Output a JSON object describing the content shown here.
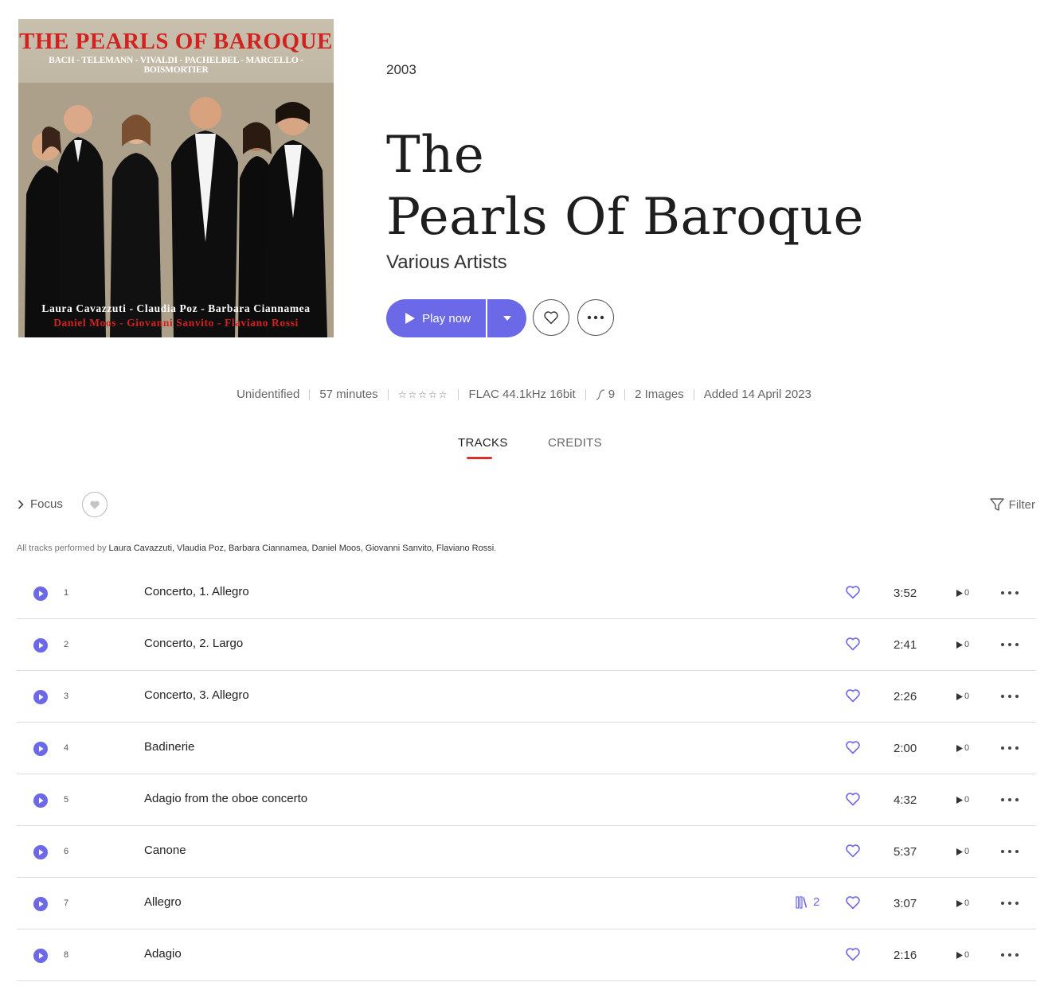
{
  "cover": {
    "title": "THE PEARLS OF BAROQUE",
    "composers": "BACH - TELEMANN - VIVALDI - PACHELBEL - MARCELLO - BOISMORTIER",
    "names_line1": "Laura Cavazzuti - Claudia Poz - Barbara Ciannamea",
    "names_line2": "Daniel Moos - Giovanni Sanvito - Flaviano Rossi"
  },
  "album": {
    "year": "2003",
    "title_line1": "The",
    "title_line2": "Pearls Of Baroque",
    "artist": "Various Artists"
  },
  "actions": {
    "play_label": "Play now"
  },
  "meta": {
    "identification": "Unidentified",
    "duration": "57 minutes",
    "rating_stars": "☆☆☆☆☆",
    "format": "FLAC 44.1kHz 16bit",
    "count": "9",
    "images": "2 Images",
    "added": "Added 14 April 2023"
  },
  "tabs": {
    "tracks": "TRACKS",
    "credits": "CREDITS"
  },
  "toolbar": {
    "focus": "Focus",
    "filter": "Filter"
  },
  "performed": {
    "prefix": "All tracks performed by",
    "names": "Laura Cavazzuti, Vlaudia Poz, Barbara Ciannamea, Daniel Moos, Giovanni Sanvito, Flaviano Rossi",
    "suffix": "."
  },
  "tracks": [
    {
      "num": "1",
      "title": "Concerto, 1. Allegro",
      "duration": "3:52",
      "plays": "0"
    },
    {
      "num": "2",
      "title": "Concerto, 2. Largo",
      "duration": "2:41",
      "plays": "0"
    },
    {
      "num": "3",
      "title": "Concerto, 3. Allegro",
      "duration": "2:26",
      "plays": "0"
    },
    {
      "num": "4",
      "title": "Badinerie",
      "duration": "2:00",
      "plays": "0"
    },
    {
      "num": "5",
      "title": "Adagio from the oboe concerto",
      "duration": "4:32",
      "plays": "0"
    },
    {
      "num": "6",
      "title": "Canone",
      "duration": "5:37",
      "plays": "0"
    },
    {
      "num": "7",
      "title": "Allegro",
      "duration": "3:07",
      "plays": "0",
      "versions": "2"
    },
    {
      "num": "8",
      "title": "Adagio",
      "duration": "2:16",
      "plays": "0"
    }
  ],
  "colors": {
    "accent": "#6c69e8",
    "tab_underline": "#d9322c",
    "cover_red": "#d1221f"
  }
}
